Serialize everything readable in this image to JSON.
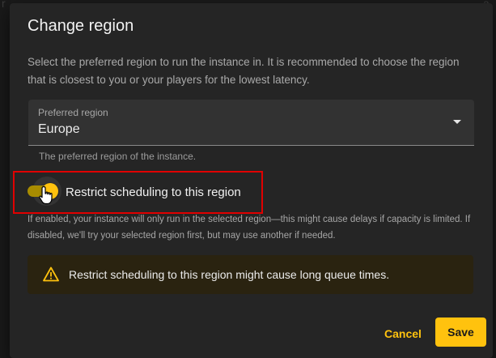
{
  "background": {
    "fragments": [
      "r",
      "a"
    ]
  },
  "dialog": {
    "title": "Change region",
    "description": "Select the preferred region to run the instance in. It is recommended to choose the region that is closest to you or your players for the lowest latency.",
    "region_select": {
      "label": "Preferred region",
      "value": "Europe",
      "helper": "The preferred region of the instance."
    },
    "restrict_toggle": {
      "label": "Restrict scheduling to this region",
      "checked": true,
      "help": "If enabled, your instance will only run in the selected region—this might cause delays if capacity is limited. If disabled, we'll try your selected region first, but may use another if needed."
    },
    "warning": {
      "icon": "warning-triangle-icon",
      "text": "Restrict scheduling to this region might cause long queue times."
    },
    "actions": {
      "cancel": "Cancel",
      "save": "Save"
    }
  },
  "colors": {
    "accent": "#ffc20e",
    "dialog_bg": "#252525",
    "highlight": "#e00000",
    "warning_bg": "#2a2310"
  }
}
